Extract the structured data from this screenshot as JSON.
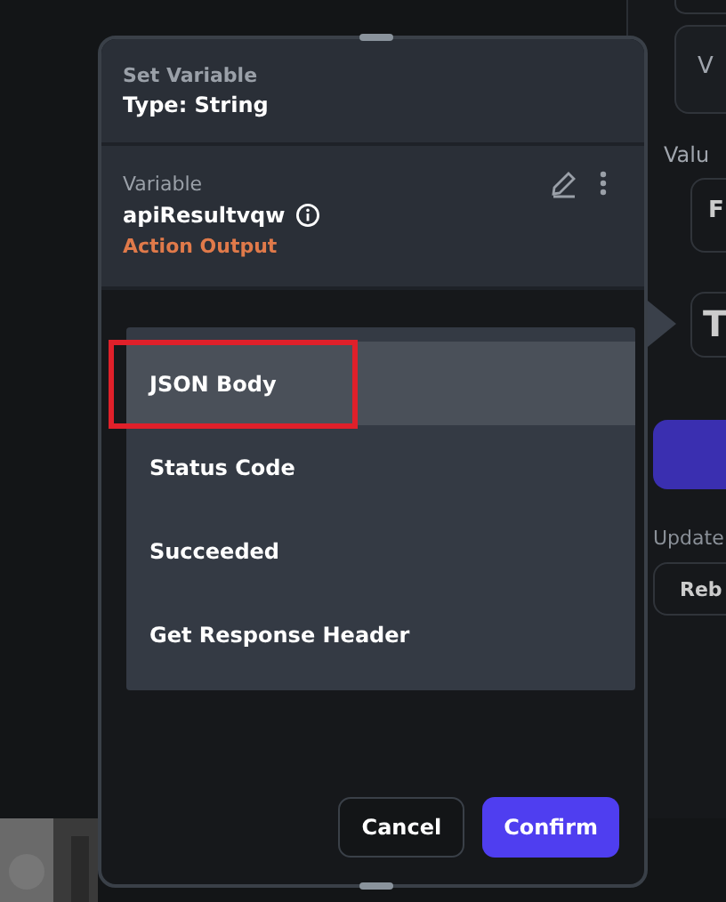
{
  "background_panel": {
    "card_label": "V",
    "value_label": "Valu",
    "field_value": "F",
    "type_box": "T",
    "update_label": "Update",
    "rebuild_button": "Reb"
  },
  "dialog": {
    "header": {
      "caption": "Set Variable",
      "title": "Type: String"
    },
    "variable": {
      "label": "Variable",
      "name": "apiResultvqw",
      "source": "Action Output"
    },
    "dropdown": [
      {
        "label": "JSON Body",
        "selected": true,
        "highlighted": true
      },
      {
        "label": "Status Code",
        "selected": false,
        "highlighted": false
      },
      {
        "label": "Succeeded",
        "selected": false,
        "highlighted": false
      },
      {
        "label": "Get Response Header",
        "selected": false,
        "highlighted": false
      }
    ],
    "buttons": [
      {
        "label": "Cancel",
        "kind": "secondary"
      },
      {
        "label": "Confirm",
        "kind": "primary"
      }
    ]
  }
}
